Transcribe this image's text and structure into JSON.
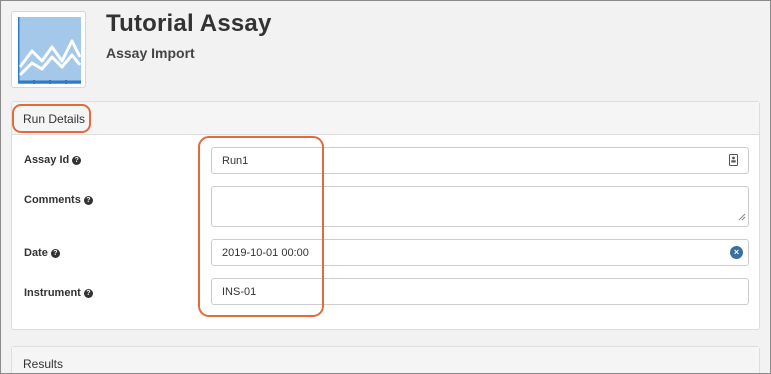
{
  "header": {
    "title": "Tutorial Assay",
    "subtitle": "Assay Import",
    "logo_icon": "assay-chart-icon",
    "logo_colors": {
      "fill": "#a3c8ea",
      "line": "#ffffff",
      "axis": "#2d7bc4"
    }
  },
  "run_details": {
    "heading": "Run Details",
    "fields": {
      "assay_id": {
        "label": "Assay Id",
        "value": "Run1",
        "icon": "id-card-icon"
      },
      "comments": {
        "label": "Comments",
        "value": ""
      },
      "date": {
        "label": "Date",
        "value": "2019-10-01 00:00",
        "icon": "clear-icon"
      },
      "instrument": {
        "label": "Instrument",
        "value": "INS-01"
      }
    },
    "help_icon": "?"
  },
  "results": {
    "heading": "Results"
  },
  "annotation_color": "#e06c3c"
}
